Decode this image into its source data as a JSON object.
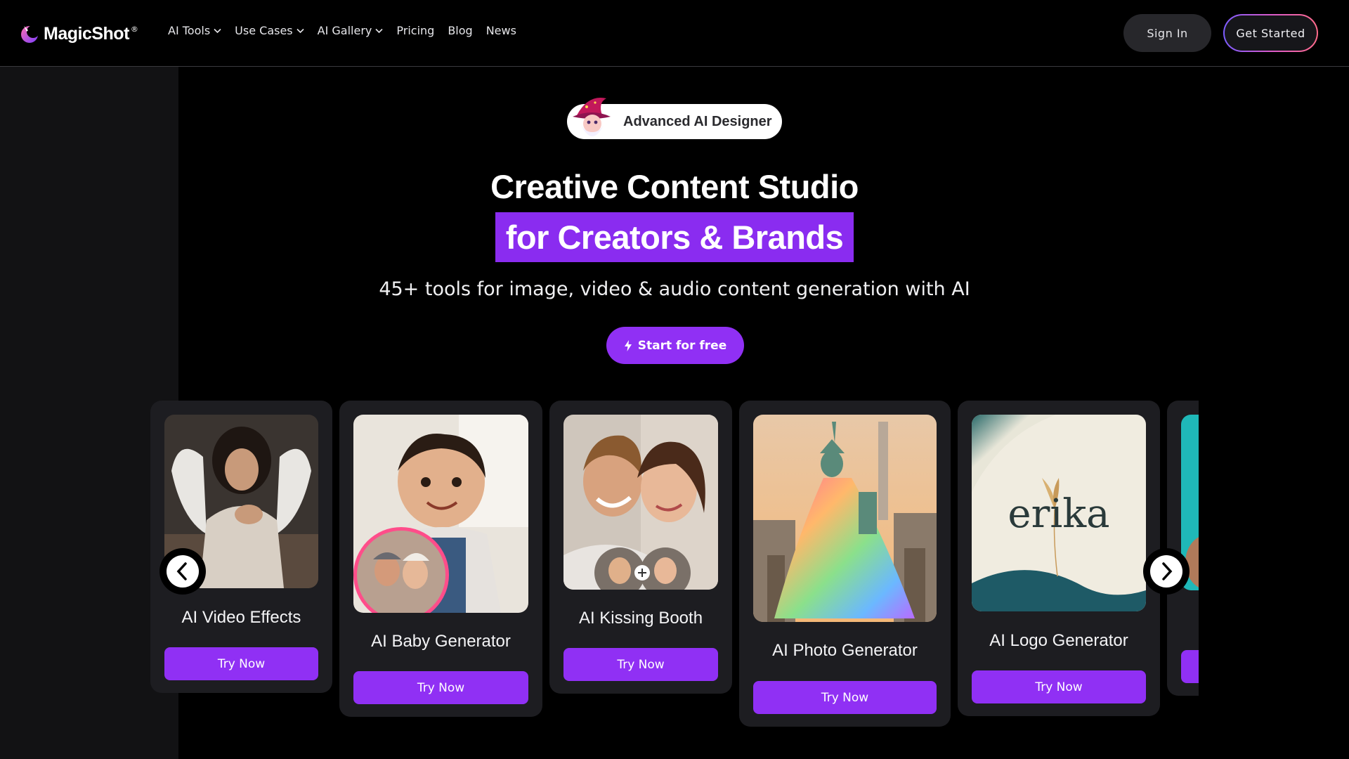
{
  "nav": {
    "logo_text": "MagicShot",
    "logo_reg": "®",
    "items": [
      {
        "label": "AI Tools",
        "has_dropdown": true
      },
      {
        "label": "Use Cases",
        "has_dropdown": true
      },
      {
        "label": "AI Gallery",
        "has_dropdown": true
      },
      {
        "label": "Pricing",
        "has_dropdown": false
      },
      {
        "label": "Blog",
        "has_dropdown": false
      },
      {
        "label": "News",
        "has_dropdown": false
      }
    ],
    "sign_in": "Sign In",
    "get_started": "Get Started"
  },
  "hero": {
    "badge": "Advanced AI Designer",
    "title": "Creative Content Studio",
    "highlight": "for Creators & Brands",
    "subtitle": "45+ tools for image, video & audio content generation with AI",
    "cta": "Start for free"
  },
  "carousel": {
    "cards": [
      {
        "title": "AI Video Effects",
        "button": "Try Now"
      },
      {
        "title": "AI Baby Generator",
        "button": "Try Now"
      },
      {
        "title": "AI Kissing Booth",
        "button": "Try Now"
      },
      {
        "title": "AI Photo Generator",
        "button": "Try Now"
      },
      {
        "title": "AI Logo Generator",
        "button": "Try Now"
      }
    ],
    "logo_sample_text": "erika"
  },
  "colors": {
    "accent": "#9030f4",
    "highlight_bg": "#8a2cf0",
    "card_bg": "#1d1d21",
    "page_bg": "#000000"
  }
}
